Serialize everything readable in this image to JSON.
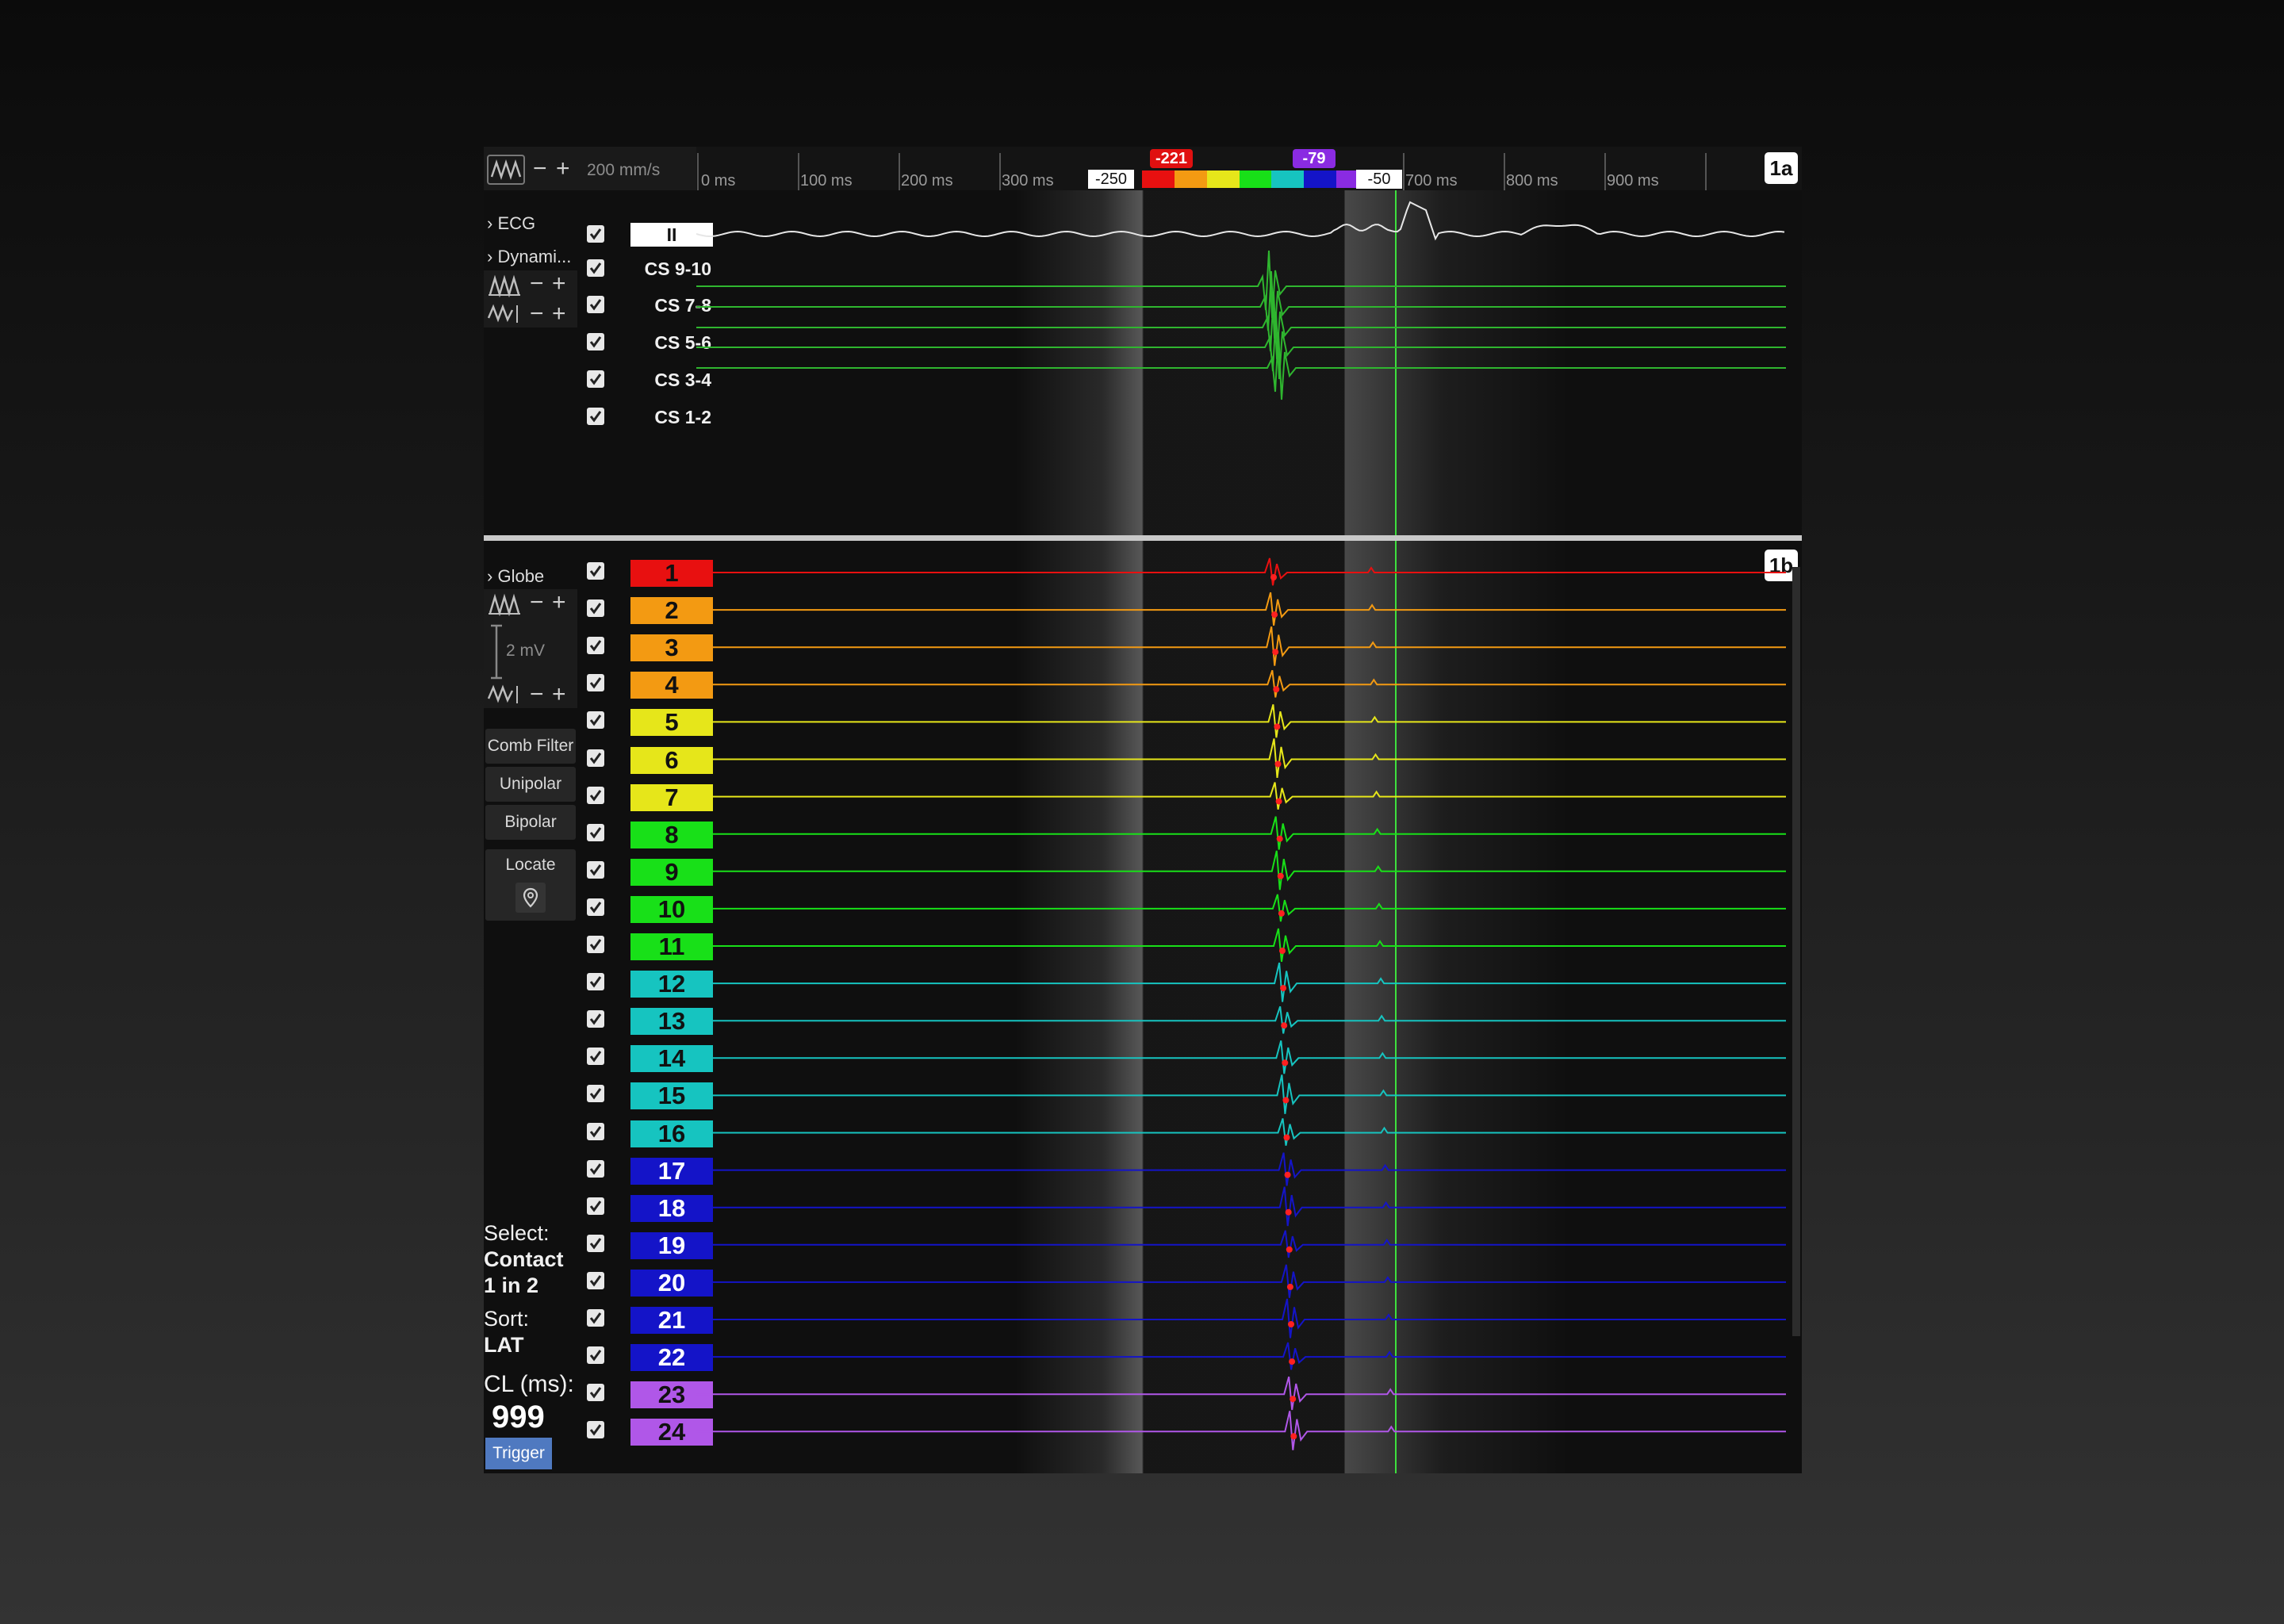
{
  "toolbar": {
    "speed_label": "200 mm/s",
    "minus": "−",
    "plus": "+"
  },
  "ruler": {
    "ticks": [
      "0 ms",
      "100 ms",
      "200 ms",
      "300 ms",
      "700 ms",
      "800 ms",
      "900 ms"
    ],
    "window_start": "-250",
    "window_end": "-50",
    "lat_min": "-221",
    "lat_max": "-79",
    "lat_min_color": "#e01010",
    "lat_max_color": "#8a2be2"
  },
  "panel_a": {
    "tag": "1a",
    "groups": [
      "ECG",
      "Dynami..."
    ],
    "channels": [
      {
        "label": "II"
      },
      {
        "label": "CS 9-10"
      },
      {
        "label": "CS 7-8"
      },
      {
        "label": "CS 5-6"
      },
      {
        "label": "CS 3-4"
      },
      {
        "label": "CS 1-2"
      }
    ]
  },
  "panel_b": {
    "tag": "1b",
    "group": "Globe",
    "scale_label": "2 mV",
    "buttons": {
      "comb_filter": "Comb Filter",
      "unipolar": "Unipolar",
      "bipolar": "Bipolar",
      "locate": "Locate"
    },
    "select_label": "Select:",
    "select_value_line1": "Contact",
    "select_value_line2": "1 in 2",
    "sort_label": "Sort:",
    "sort_value": "LAT",
    "cl_label": "CL (ms):",
    "cl_value": "999",
    "trigger_label": "Trigger",
    "channels": [
      {
        "label": "1",
        "color": "#e81010"
      },
      {
        "label": "2",
        "color": "#f39a12"
      },
      {
        "label": "3",
        "color": "#f39a12"
      },
      {
        "label": "4",
        "color": "#f39a12"
      },
      {
        "label": "5",
        "color": "#e6e61a"
      },
      {
        "label": "6",
        "color": "#e6e61a"
      },
      {
        "label": "7",
        "color": "#e6e61a"
      },
      {
        "label": "8",
        "color": "#18e018"
      },
      {
        "label": "9",
        "color": "#18e018"
      },
      {
        "label": "10",
        "color": "#18e018"
      },
      {
        "label": "11",
        "color": "#18e018"
      },
      {
        "label": "12",
        "color": "#16c4c0"
      },
      {
        "label": "13",
        "color": "#16c4c0"
      },
      {
        "label": "14",
        "color": "#16c4c0"
      },
      {
        "label": "15",
        "color": "#16c4c0"
      },
      {
        "label": "16",
        "color": "#16c4c0"
      },
      {
        "label": "17",
        "color": "#1414c8"
      },
      {
        "label": "18",
        "color": "#1414c8"
      },
      {
        "label": "19",
        "color": "#1414c8"
      },
      {
        "label": "20",
        "color": "#1414c8"
      },
      {
        "label": "21",
        "color": "#1414c8"
      },
      {
        "label": "22",
        "color": "#1414c8"
      },
      {
        "label": "23",
        "color": "#b057e8"
      },
      {
        "label": "24",
        "color": "#b057e8"
      }
    ]
  }
}
